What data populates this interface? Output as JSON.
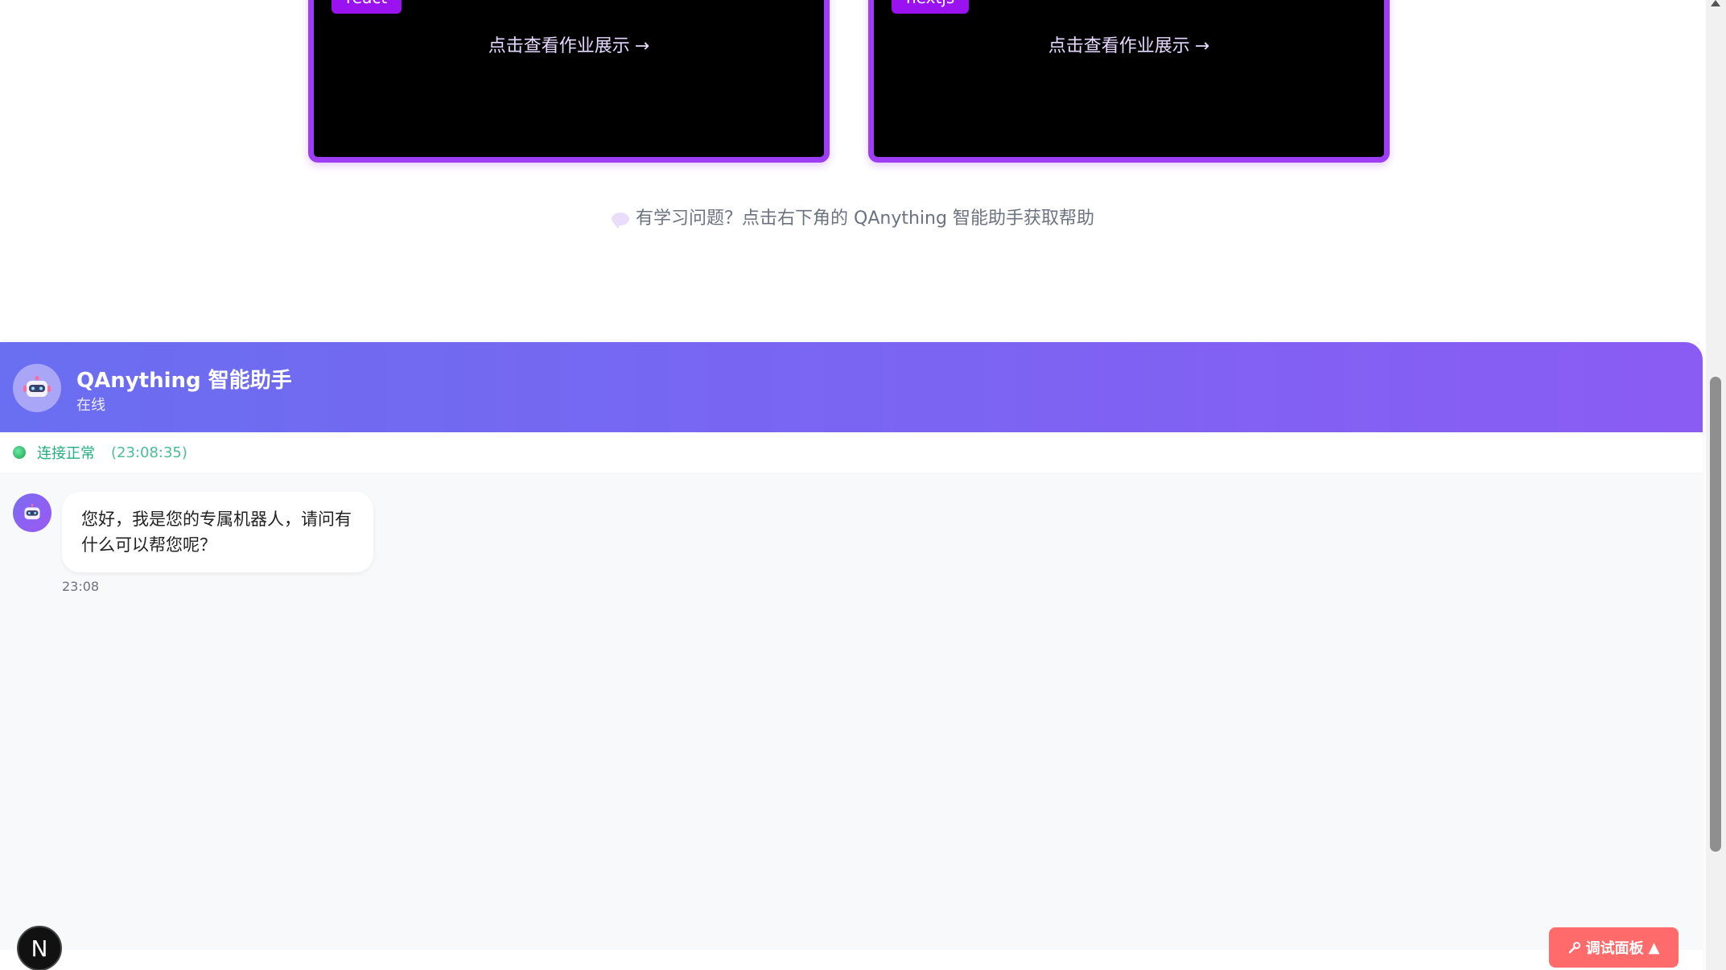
{
  "cards": [
    {
      "tag": "react",
      "link_text": "点击查看作业展示",
      "arrow": "→"
    },
    {
      "tag": "nextjs",
      "link_text": "点击查看作业展示",
      "arrow": "→"
    }
  ],
  "help_hint": {
    "icon": "speech-bubble-icon",
    "text": "有学习问题？点击右下角的 QAnything 智能助手获取帮助"
  },
  "chat": {
    "title": "QAnything 智能助手",
    "subtitle": "在线",
    "avatar_icon": "robot-icon",
    "status": {
      "label": "连接正常",
      "time": "(23:08:35)",
      "color": "#22b07d"
    },
    "messages": [
      {
        "sender": "bot",
        "text": "您好，我是您的专属机器人，请问有什么可以帮您呢？",
        "time": "23:08"
      }
    ]
  },
  "next_badge": {
    "label": "N"
  },
  "debug_button": {
    "icon": "wrench-icon",
    "label": "调试面板",
    "chevron": "▲",
    "color": "#ff6b6b"
  },
  "colors": {
    "card_border": "#9d3df5",
    "header_gradient_start": "#6a6ef0",
    "header_gradient_end": "#8a5cf4"
  }
}
